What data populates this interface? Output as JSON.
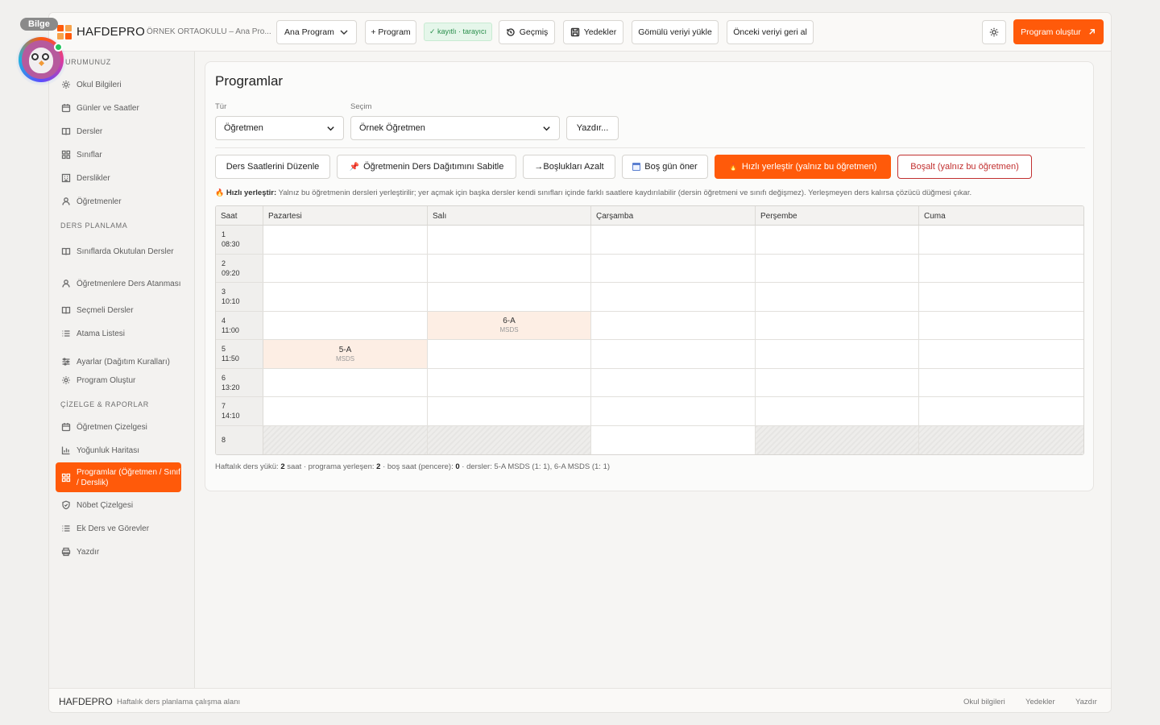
{
  "topbar": {
    "brand": "HAFDEPRO",
    "school": "ÖRNEK ORTAOKULU – Ana Pro...",
    "program_select": "Ana Program",
    "add_program": "+ Program",
    "badge": "✓ kayıtlı · tarayıcı",
    "history": "Geçmiş",
    "backups": "Yedekler",
    "load_embedded": "Gömülü veriyi yükle",
    "restore_previous": "Önceki veriyi geri al",
    "create_program": "Program oluştur"
  },
  "assistant": {
    "name": "Bilge"
  },
  "sidebar": {
    "sections": [
      {
        "title": "URUMUNUZ",
        "items": [
          {
            "label": "Okul Bilgileri",
            "icon": "settings-icon"
          },
          {
            "label": "Günler ve Saatler",
            "icon": "calendar-icon"
          },
          {
            "label": "Dersler",
            "icon": "book-icon"
          },
          {
            "label": "Sınıflar",
            "icon": "grid-icon"
          },
          {
            "label": "Derslikler",
            "icon": "building-icon"
          },
          {
            "label": "Öğretmenler",
            "icon": "user-icon"
          }
        ]
      },
      {
        "title": "DERS PLANLAMA",
        "items": [
          {
            "label": "Sınıflarda Okutulan Dersler",
            "icon": "book-icon"
          },
          {
            "label": "Öğretmenlere Ders Atanması",
            "icon": "user-icon"
          },
          {
            "label": "Seçmeli Dersler",
            "icon": "book-icon"
          },
          {
            "label": "Atama Listesi",
            "icon": "list-icon"
          },
          {
            "label": "Ayarlar (Dağıtım Kuralları)",
            "icon": "sliders-icon"
          },
          {
            "label": "Program Oluştur",
            "icon": "gear-icon"
          }
        ]
      },
      {
        "title": "ÇİZELGE & RAPORLAR",
        "items": [
          {
            "label": "Öğretmen Çizelgesi",
            "icon": "calendar-icon"
          },
          {
            "label": "Yoğunluk Haritası",
            "icon": "chart-icon"
          },
          {
            "label": "Programlar (Öğretmen / Sınıf / Derslik)",
            "icon": "grid-icon",
            "active": true
          },
          {
            "label": "Nöbet Çizelgesi",
            "icon": "shield-icon"
          },
          {
            "label": "Ek Ders ve Görevler",
            "icon": "list-icon"
          },
          {
            "label": "Yazdır",
            "icon": "printer-icon"
          }
        ]
      }
    ]
  },
  "main": {
    "title": "Programlar",
    "type_label": "Tür",
    "type_value": "Öğretmen",
    "selection_label": "Seçim",
    "selection_value": "Örnek Öğretmen",
    "print_button": "Yazdır...",
    "actions": {
      "edit_hours": "Ders Saatlerini Düzenle",
      "pin_distribution": "Öğretmenin Ders Dağıtımını Sabitle",
      "reduce_gaps": "→Boşlukları Azalt",
      "suggest_free_day": "Boş gün öner",
      "quick_place": "Hızlı yerleştir (yalnız bu öğretmen)",
      "clear": "Boşalt (yalnız bu öğretmen)"
    },
    "hint_title": "Hızlı yerleştir:",
    "hint_text": "Yalnız bu öğretmenin dersleri yerleştirilir; yer açmak için başka dersler kendi sınıfları içinde farklı saatlere kaydırılabilir (dersin öğretmeni ve sınıfı değişmez). Yerleşmeyen ders kalırsa çözücü düğmesi çıkar.",
    "table": {
      "headers": [
        "Saat",
        "Pazartesi",
        "Salı",
        "Çarşamba",
        "Perşembe",
        "Cuma"
      ],
      "rows": [
        {
          "no": "1",
          "time": "08:30",
          "cells": [
            null,
            null,
            null,
            null,
            null
          ]
        },
        {
          "no": "2",
          "time": "09:20",
          "cells": [
            null,
            null,
            null,
            null,
            null
          ]
        },
        {
          "no": "3",
          "time": "10:10",
          "cells": [
            null,
            null,
            null,
            null,
            null
          ]
        },
        {
          "no": "4",
          "time": "11:00",
          "cells": [
            null,
            {
              "cls": "6-A",
              "course": "MSDS"
            },
            null,
            null,
            null
          ]
        },
        {
          "no": "5",
          "time": "11:50",
          "cells": [
            {
              "cls": "5-A",
              "course": "MSDS"
            },
            null,
            null,
            null,
            null
          ]
        },
        {
          "no": "6",
          "time": "13:20",
          "cells": [
            null,
            null,
            null,
            null,
            null
          ]
        },
        {
          "no": "7",
          "time": "14:10",
          "cells": [
            null,
            null,
            null,
            null,
            null
          ]
        },
        {
          "no": "8",
          "time": "",
          "cells": [
            "blocked",
            "blocked",
            null,
            "blocked",
            "blocked"
          ]
        }
      ]
    },
    "summary": {
      "p1": "Haftalık ders yükü: ",
      "load": "2",
      "p2": " saat · programa yerleşen: ",
      "placed": "2",
      "p3": " · boş saat (pencere): ",
      "gaps": "0",
      "p4": " · dersler: 5-A MSDS (1: 1), 6-A MSDS (1: 1)"
    }
  },
  "footer": {
    "brand": "HAFDEPRO",
    "subtitle": "Haftalık ders planlama çalışma alanı",
    "links": [
      "Okul bilgileri",
      "Yedekler",
      "Yazdır"
    ]
  },
  "colors": {
    "accent": "#ff5a0a",
    "danger": "#c23030",
    "success": "#2a8f4c",
    "slot_filled": "#fdeee4"
  }
}
